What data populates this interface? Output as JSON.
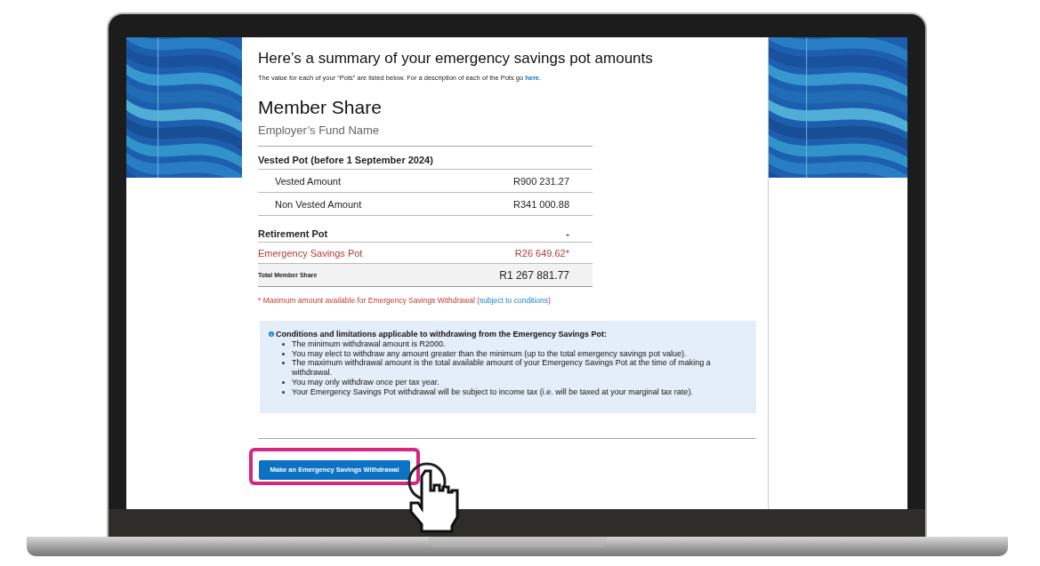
{
  "heading": "Here’s a summary of your emergency savings pot amounts",
  "intro": {
    "text": "The value for each of your “Pots” are listed below. For a description of each of the Pots go ",
    "link": "here",
    "end": "."
  },
  "section_title": "Member Share",
  "subtitle": "Employer’s Fund Name",
  "rows": [
    {
      "kind": "group",
      "label": "Vested Pot (before 1 September 2024)"
    },
    {
      "kind": "sub",
      "label": "Vested Amount",
      "value": "R900 231.27"
    },
    {
      "kind": "sub",
      "label": "Non Vested Amount",
      "value": "R341 000.88"
    },
    {
      "kind": "pot",
      "label": "Retirement Pot",
      "value": "-"
    },
    {
      "kind": "highlight",
      "label": "Emergency Savings Pot",
      "value": "R26 649.62*"
    },
    {
      "kind": "total",
      "label": "Total Member Share",
      "value": "R1 267 881.77"
    }
  ],
  "footnote": {
    "text": "* Maximum amount available for Emergency Savings Withdrawal (",
    "link": "subject to conditions",
    "end": ")"
  },
  "conditions": {
    "title": "Conditions and limitations applicable to withdrawing from the Emergency Savings Pot:",
    "items": [
      "The minimum withdrawal amount is R2000.",
      "You may elect to withdraw any amount greater than the minimum (up to the total emergency savings pot value).",
      "The maximum withdrawal amount is the total available amount of your Emergency Savings Pot at the time of making a withdrawal.",
      "You may only withdraw once per tax year.",
      "Your Emergency Savings Pot withdrawal will be subject to income tax (i.e. will be taxed at your marginal tax rate)."
    ]
  },
  "button": "Make an Emergency Savings Withdrawal"
}
